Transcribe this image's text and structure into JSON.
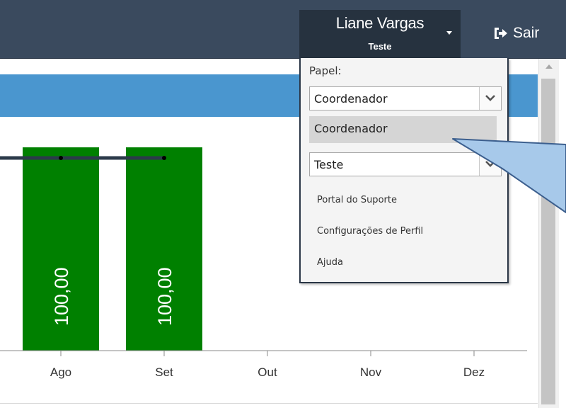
{
  "header": {
    "user_name": "Liane Vargas",
    "user_subtitle": "Teste",
    "logout_label": "Sair",
    "logout_icon": "sign-out-icon",
    "background_color": "#3a4a5e"
  },
  "dropdown": {
    "role_label": "Papel:",
    "role_selected": "Coordenador",
    "highlighted_option": "Coordenador",
    "org_selected": "Teste",
    "menu_items": [
      "Portal do Suporte",
      "Configurações de Perfil",
      "Ajuda"
    ]
  },
  "chart_data": {
    "type": "bar",
    "categories": [
      "Ago",
      "Set",
      "Out",
      "Nov",
      "Dez"
    ],
    "values": [
      100,
      100,
      null,
      null,
      null
    ],
    "value_labels": [
      "100,00",
      "100,00",
      "",
      "",
      ""
    ],
    "line_series_values": [
      100,
      100,
      null,
      null,
      null
    ],
    "bar_color": "#008000",
    "line_color": "#2b3a4a",
    "ylim": [
      0,
      100
    ]
  }
}
